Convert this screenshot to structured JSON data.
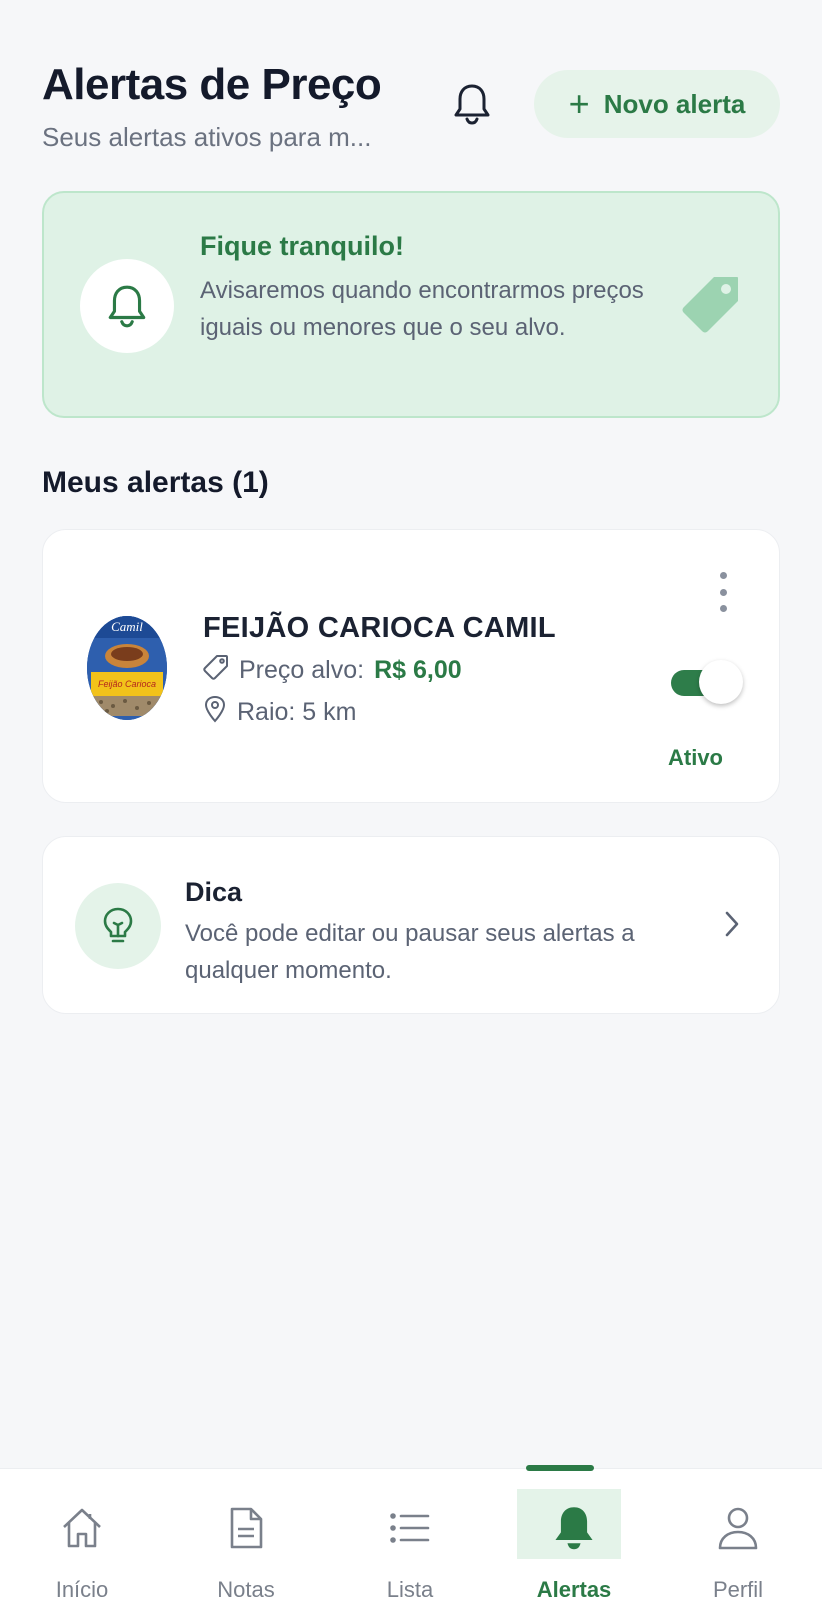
{
  "header": {
    "title": "Alertas de Preço",
    "subtitle": "Seus alertas ativos para m...",
    "new_alert_label": "Novo alerta",
    "new_alert_icon": "plus-icon",
    "bell_icon": "bell-icon"
  },
  "info_card": {
    "icon": "bell-icon",
    "title": "Fique tranquilo!",
    "body": "Avisaremos quando encontrarmos preços iguais ou menores que o seu alvo.",
    "decoration_icon": "tag-icon"
  },
  "section": {
    "title": "Meus alertas (1)"
  },
  "alerts": [
    {
      "product_name": "FEIJÃO CARIOCA CAMIL",
      "price_label": "Preço alvo:",
      "price_value": "R$ 6,00",
      "radius_label": "Raio: 5 km",
      "status_label": "Ativo",
      "active": true
    }
  ],
  "tip": {
    "icon": "lightbulb-icon",
    "title": "Dica",
    "body": "Você pode editar ou pausar seus alertas a qualquer momento."
  },
  "nav": {
    "items": [
      {
        "label": "Início",
        "icon": "home-icon"
      },
      {
        "label": "Notas",
        "icon": "document-icon"
      },
      {
        "label": "Lista",
        "icon": "list-icon"
      },
      {
        "label": "Alertas",
        "icon": "bell-icon",
        "active": true
      },
      {
        "label": "Perfil",
        "icon": "user-icon"
      }
    ]
  },
  "colors": {
    "accent": "#2b7a46",
    "background": "#f6f7f9",
    "info_card_bg": "#dff2e6"
  }
}
